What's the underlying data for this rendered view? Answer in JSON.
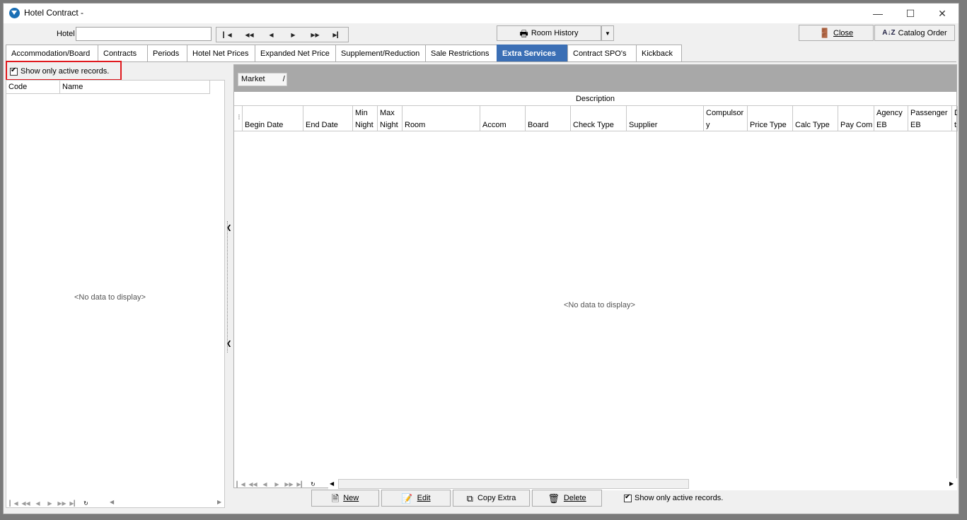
{
  "window": {
    "title": "Hotel Contract -"
  },
  "toolbar": {
    "hotel_label": "Hotel",
    "hotel_value": "",
    "room_history_label": "Room History",
    "close_label": "Close",
    "catalog_order_label": "Catalog Order"
  },
  "tabs": [
    {
      "label": "Accommodation/Board"
    },
    {
      "label": "Contracts"
    },
    {
      "label": "Periods"
    },
    {
      "label": "Hotel Net Prices"
    },
    {
      "label": "Expanded Net Price"
    },
    {
      "label": "Supplement/Reduction"
    },
    {
      "label": "Sale Restrictions"
    },
    {
      "label": "Extra Services"
    },
    {
      "label": "Contract SPO's"
    },
    {
      "label": "Kickback"
    }
  ],
  "active_tab": "Extra Services",
  "left_panel": {
    "show_active_label": "Show only active records.",
    "show_active_checked": true,
    "columns": [
      "Code",
      "Name"
    ],
    "empty_text": "<No data to display>"
  },
  "right_panel": {
    "group_by": "Market",
    "group_sort": "/",
    "band_header": "Description",
    "columns": [
      {
        "top": "",
        "bottom": "Begin Date"
      },
      {
        "top": "",
        "bottom": "End Date"
      },
      {
        "top": "Min",
        "bottom": "Night"
      },
      {
        "top": "Max",
        "bottom": "Night"
      },
      {
        "top": "",
        "bottom": "Room"
      },
      {
        "top": "",
        "bottom": "Accom"
      },
      {
        "top": "",
        "bottom": "Board"
      },
      {
        "top": "",
        "bottom": "Check Type"
      },
      {
        "top": "",
        "bottom": "Supplier"
      },
      {
        "top": "Compulsor",
        "bottom": "y"
      },
      {
        "top": "",
        "bottom": "Price Type"
      },
      {
        "top": "",
        "bottom": "Calc Type"
      },
      {
        "top": "",
        "bottom": "Pay Com"
      },
      {
        "top": "Agency",
        "bottom": "EB"
      },
      {
        "top": "Passenger",
        "bottom": "EB"
      },
      {
        "top": "D",
        "bottom": "t"
      }
    ],
    "empty_text": "<No data to display>"
  },
  "bottom_buttons": {
    "new_label": "New",
    "edit_label": "Edit",
    "copy_extra_label": "Copy Extra",
    "delete_label": "Delete",
    "show_active_label": "Show only active records.",
    "show_active_checked": true
  }
}
